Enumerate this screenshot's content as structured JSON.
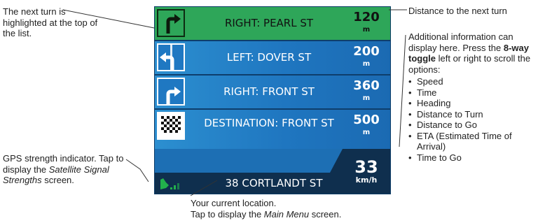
{
  "callouts": {
    "next_turn": "The next turn is highlighted at the top of the list.",
    "distance": "Distance to the next turn",
    "additional_prefix": "Additional information can display here. Press the ",
    "additional_bold": "8-way toggle",
    "additional_suffix": " left or right to scroll the options:",
    "options": [
      "Speed",
      "Time",
      "Heading",
      "Distance to Turn",
      "Distance to Go",
      "ETA (Estimated Time of Arrival)",
      "Time to Go"
    ],
    "gps_prefix": "GPS strength indicator. Tap to display the ",
    "gps_italic": "Satellite Signal Strengths",
    "gps_suffix": "  screen.",
    "location_line1": "Your current location.",
    "location_line2_prefix": "Tap to display the ",
    "location_line2_italic": "Main Menu",
    "location_line2_suffix": " screen."
  },
  "turns": [
    {
      "icon": "turn-right-icon",
      "street": "RIGHT: PEARL ST",
      "distance": "120",
      "unit": "m",
      "active": true
    },
    {
      "icon": "turn-left-icon",
      "street": "LEFT: DOVER ST",
      "distance": "200",
      "unit": "m",
      "active": false
    },
    {
      "icon": "turn-right-icon",
      "street": "RIGHT: FRONT ST",
      "distance": "360",
      "unit": "m",
      "active": false
    },
    {
      "icon": "checkered-flag-icon",
      "street": "DESTINATION: FRONT ST",
      "distance": "500",
      "unit": "m",
      "active": false
    }
  ],
  "status": {
    "location": "38 CORTLANDT ST",
    "speed": "33",
    "speed_unit": "km/h"
  },
  "colors": {
    "active_row": "#2ea659",
    "row_blue": "#1f76c0",
    "status_bar": "#0f2f4e",
    "gps_green": "#22b14c"
  }
}
